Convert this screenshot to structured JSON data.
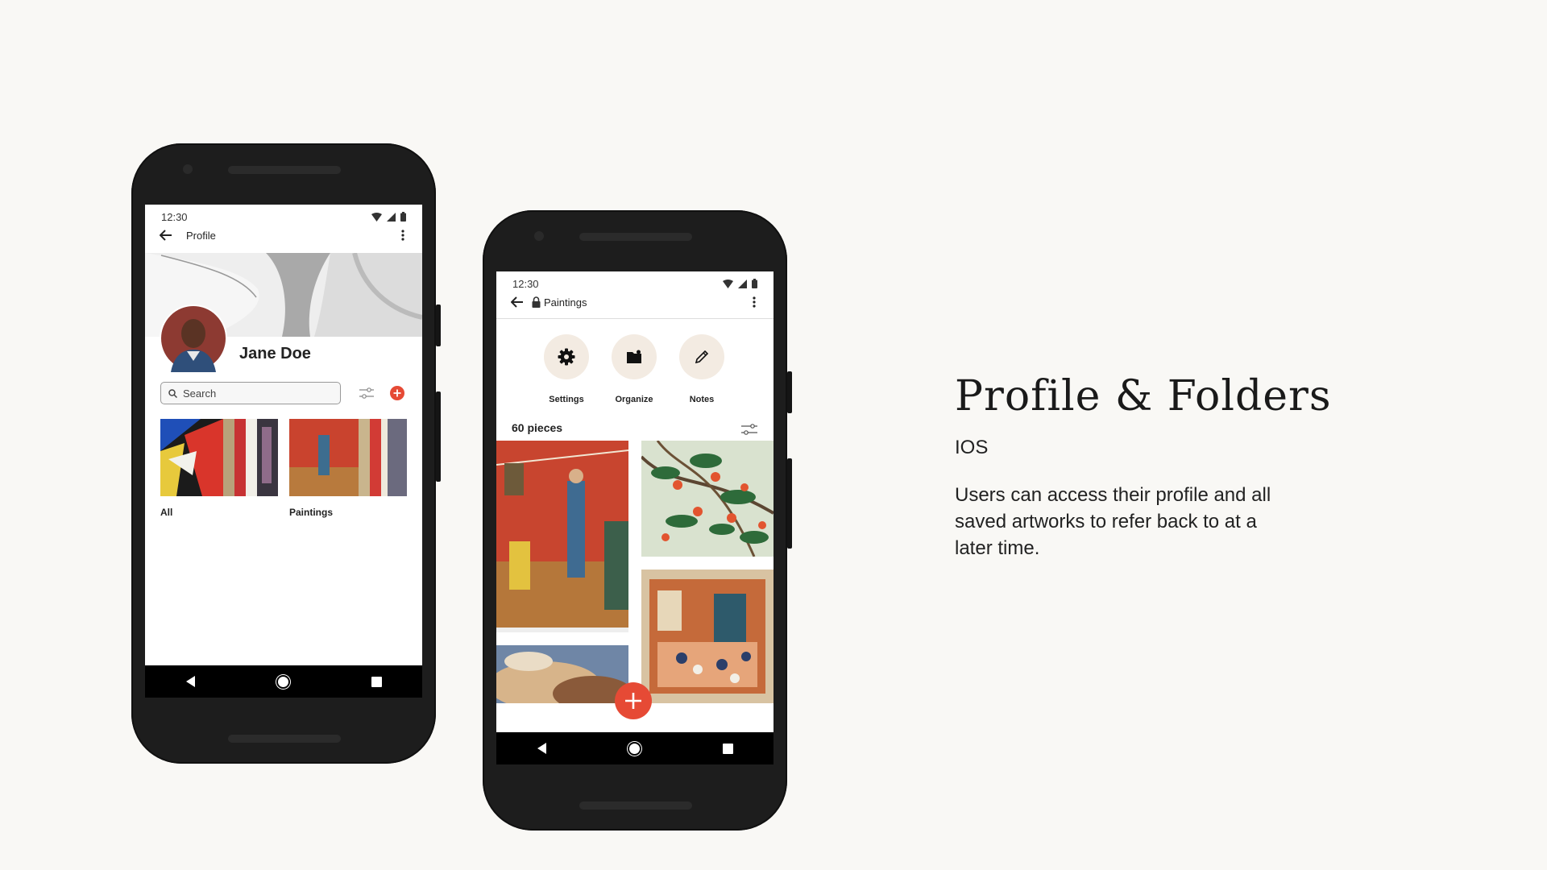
{
  "phone1": {
    "status_time": "12:30",
    "appbar_title": "Profile",
    "user_name": "Jane Doe",
    "search_placeholder": "Search",
    "folders": [
      {
        "label": "All"
      },
      {
        "label": "Paintings"
      }
    ]
  },
  "phone2": {
    "status_time": "12:30",
    "appbar_title": "Paintings",
    "actions": [
      {
        "label": "Settings",
        "icon": "gear-icon"
      },
      {
        "label": "Organize",
        "icon": "folder-icon"
      },
      {
        "label": "Notes",
        "icon": "pencil-icon"
      }
    ],
    "count_label": "60 pieces"
  },
  "panel": {
    "headline": "Profile & Folders",
    "platform": "IOS",
    "description": "Users can access their profile and all saved artworks to refer back to at a later time."
  },
  "colors": {
    "accent": "#e64a35",
    "background": "#f9f8f5",
    "action_bg": "#f3ebe2",
    "phone_body": "#1d1d1d"
  }
}
